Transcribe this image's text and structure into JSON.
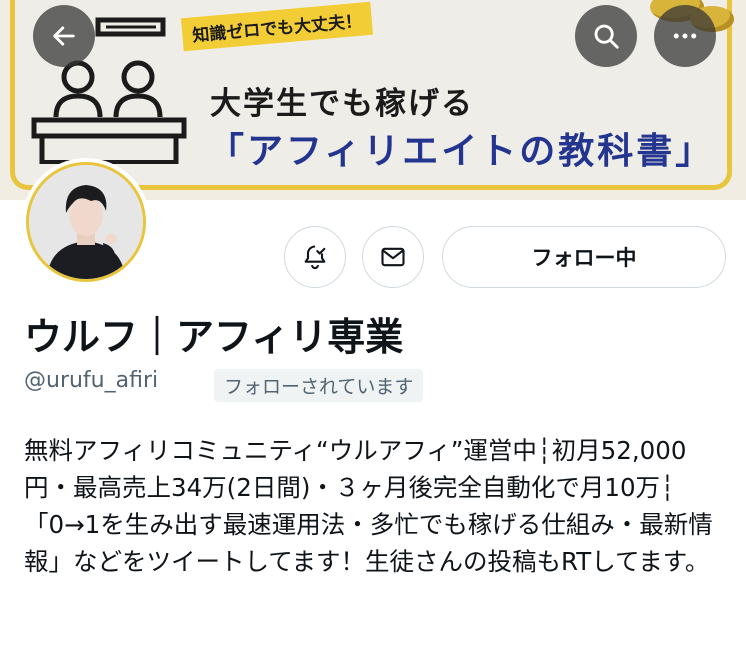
{
  "banner": {
    "tag": "知識ゼロでも大丈夫！",
    "headline_line1": "大学生でも稼げる",
    "headline_line2": "「アフィリエイトの教科書」"
  },
  "header": {
    "back_icon": "arrow-left-icon",
    "search_icon": "search-icon",
    "more_icon": "more-horizontal-icon"
  },
  "profile": {
    "display_name": "ウルフ｜アフィリ専業",
    "handle": "@urufu_afiri",
    "follows_you_label": "フォローされています",
    "bio": "無料アフィリコミュニティ“ウルアフィ”運営中┆初月52,000円・最高売上34万(2日間)・３ヶ月後完全自動化で月10万┆「0→1を生み出す最速運用法・多忙でも稼げる仕組み・最新情報」などをツイートしてます！生徒さんの投稿もRTしてます。"
  },
  "actions": {
    "notify_icon": "bell-check-icon",
    "message_icon": "mail-icon",
    "follow_label": "フォロー中"
  },
  "colors": {
    "banner_accent": "#e8c53c",
    "headline_blue": "#24358f",
    "muted_text": "#536471",
    "border": "#cfd9de"
  }
}
